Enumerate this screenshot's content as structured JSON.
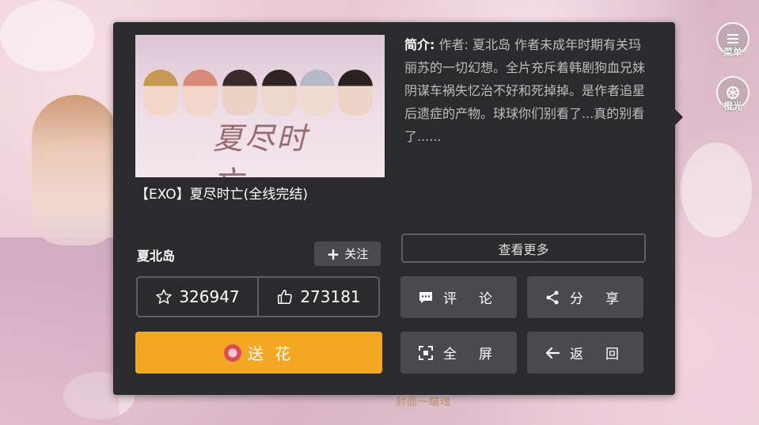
{
  "side_buttons": [
    {
      "label": "菜单",
      "icon": "menu-icon"
    },
    {
      "label": "橙光",
      "icon": "orange-light-icon"
    }
  ],
  "background_caption": "封面一瞄魂",
  "work": {
    "cover_title": "夏尽时亡",
    "title": "【EXO】夏尽时亡(全线完结)",
    "intro_label": "简介:",
    "intro_text": " 作者: 夏北岛 作者未成年时期有关玛丽苏的一切幻想。全片充斥着韩剧狗血兄妹阴谋车祸失忆治不好和死掉掉。是作者追星后遗症的产物。球球你们别看了...真的别看了......",
    "author": "夏北岛"
  },
  "buttons": {
    "follow": "关注",
    "more": "查看更多",
    "flower": "送 花",
    "comment": "评论",
    "share": "分享",
    "fullscreen": "全屏",
    "back": "返回"
  },
  "stats": {
    "favorites": "326947",
    "likes": "273181"
  },
  "colors": {
    "panel_bg": "#2b2b2d",
    "button_bg": "#4a4a4e",
    "flower_bg": "#f4a722"
  }
}
